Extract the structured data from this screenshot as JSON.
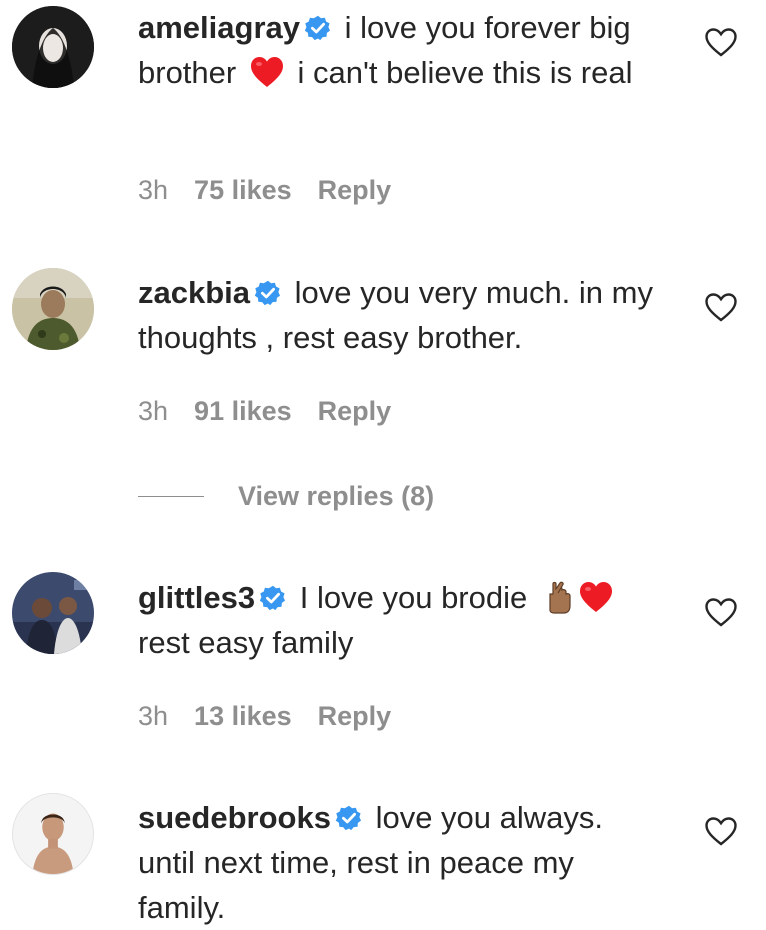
{
  "colors": {
    "text": "#262626",
    "muted": "#8e8e8e",
    "verified_blue": "#3897f0",
    "heart_red": "#ed1c24"
  },
  "comments": [
    {
      "username": "ameliagray",
      "text_part1": "i love you forever big brother",
      "text_part2": "i can't believe this is real",
      "time": "3h",
      "likes": "75 likes",
      "reply_label": "Reply",
      "emoji": [
        "red-heart"
      ]
    },
    {
      "username": "zackbia",
      "text_part1": "love you very much. in my thoughts , rest easy brother.",
      "time": "3h",
      "likes": "91 likes",
      "reply_label": "Reply",
      "view_replies": "View replies (8)"
    },
    {
      "username": "glittles3",
      "text_part1": "I love you brodie",
      "text_part2": "rest easy family",
      "time": "3h",
      "likes": "13 likes",
      "reply_label": "Reply",
      "emoji": [
        "fingers-crossed-medium-skin",
        "red-heart"
      ]
    },
    {
      "username": "suedebrooks",
      "text_part1": "love you always. until next time, rest in peace my family.",
      "emoji": []
    }
  ]
}
